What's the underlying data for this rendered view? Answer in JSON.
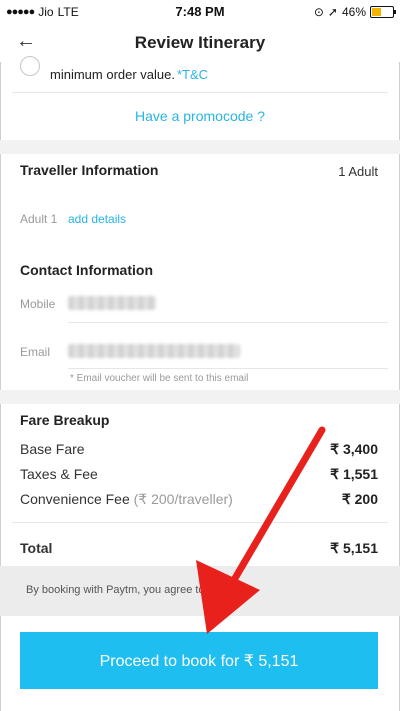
{
  "status_bar": {
    "carrier": "Jio",
    "network": "LTE",
    "time": "7:48 PM",
    "battery_pct": "46%"
  },
  "nav": {
    "back_icon": "back-arrow-icon",
    "title": "Review Itinerary"
  },
  "offer": {
    "text": "minimum order value.",
    "tc": "*T&C"
  },
  "promo": {
    "label": "Have a promocode ?"
  },
  "traveller": {
    "heading": "Traveller Information",
    "count": "1 Adult",
    "adult_label": "Adult 1",
    "add_details": "add details"
  },
  "contact": {
    "heading": "Contact Information",
    "mobile_label": "Mobile",
    "email_label": "Email",
    "email_note": "* Email voucher will be sent to this email"
  },
  "fare": {
    "heading": "Fare Breakup",
    "base_label": "Base Fare",
    "base_amount": "₹ 3,400",
    "taxes_label": "Taxes & Fee",
    "taxes_amount": "₹ 1,551",
    "conv_label": "Convenience Fee",
    "conv_sub": "(₹ 200/traveller)",
    "conv_amount": "₹ 200",
    "total_label": "Total",
    "total_amount": "₹ 5,151"
  },
  "agreement": {
    "text": "By booking with Paytm, you agree to o",
    "tc": "C"
  },
  "cta": {
    "label": "Proceed to book for ₹ 5,151"
  },
  "colors": {
    "accent": "#29b4e6",
    "cta_bg": "#1ebef0",
    "arrow": "#e8211c",
    "battery": "#f2b400"
  }
}
